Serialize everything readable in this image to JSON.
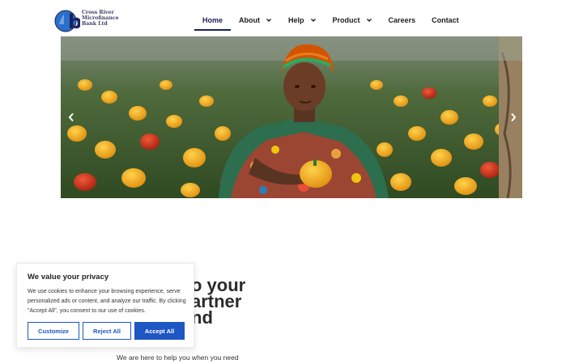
{
  "brand": {
    "name_line1": "Cross River",
    "name_line2": "Microfinance",
    "name_line3": "Bank Ltd",
    "logo_letter": "b",
    "colors": {
      "navy": "#1a2358",
      "blue": "#1e56c4",
      "logo_blue": "#2a6fc9"
    }
  },
  "nav": {
    "items": [
      {
        "label": "Home",
        "active": true,
        "dropdown": false
      },
      {
        "label": "About",
        "active": false,
        "dropdown": true
      },
      {
        "label": "Help",
        "active": false,
        "dropdown": true
      },
      {
        "label": "Product",
        "active": false,
        "dropdown": true
      },
      {
        "label": "Careers",
        "active": false,
        "dropdown": false
      },
      {
        "label": "Contact",
        "active": false,
        "dropdown": false
      }
    ]
  },
  "hero": {
    "prev_icon": "chevron-left-icon",
    "next_icon": "chevron-right-icon"
  },
  "intro": {
    "heading_line1": "o your",
    "heading_line2": "artner",
    "heading_line3": "nd",
    "text": "We are here to help you when you need"
  },
  "cookie": {
    "title": "We value your privacy",
    "text": "We use cookies to enhance your browsing experience, serve personalized ads or content, and analyze our traffic. By clicking \"Accept All\", you consent to our use of cookies.",
    "customize_label": "Customize",
    "reject_label": "Reject All",
    "accept_label": "Accept All"
  }
}
